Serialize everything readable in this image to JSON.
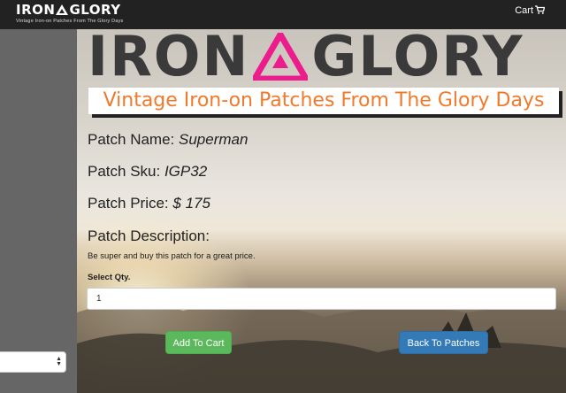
{
  "navbar": {
    "logo_left": "IRON",
    "logo_right": "GLORY",
    "logo_tagline": "Vintage Iron-on Patches From The Glory Days",
    "cart_label": "Cart",
    "cart_icon": "shopping-cart-icon"
  },
  "hero": {
    "logo_left": "IRON",
    "logo_right": "GLORY",
    "tagline": "Vintage Iron-on Patches From The Glory Days"
  },
  "patch": {
    "name_label": "Patch Name:",
    "name_value": "Superman",
    "sku_label": "Patch Sku:",
    "sku_value": "IGP32",
    "price_label": "Patch Price:",
    "price_value": "$ 175",
    "description_label": "Patch Description:",
    "description_text": "Be super and buy this patch for a great price."
  },
  "form": {
    "qty_label": "Select Qty.",
    "qty_value": "1",
    "add_button": "Add To Cart",
    "back_button": "Back To Patches"
  },
  "sidebar": {
    "select_value": ""
  },
  "colors": {
    "navbar": "#222222",
    "sidebar": "#666666",
    "logo_accent": "#ec1c8c",
    "tagline": "#f07a2c",
    "add_button": "#5cb85c",
    "back_button": "#337ab7"
  }
}
